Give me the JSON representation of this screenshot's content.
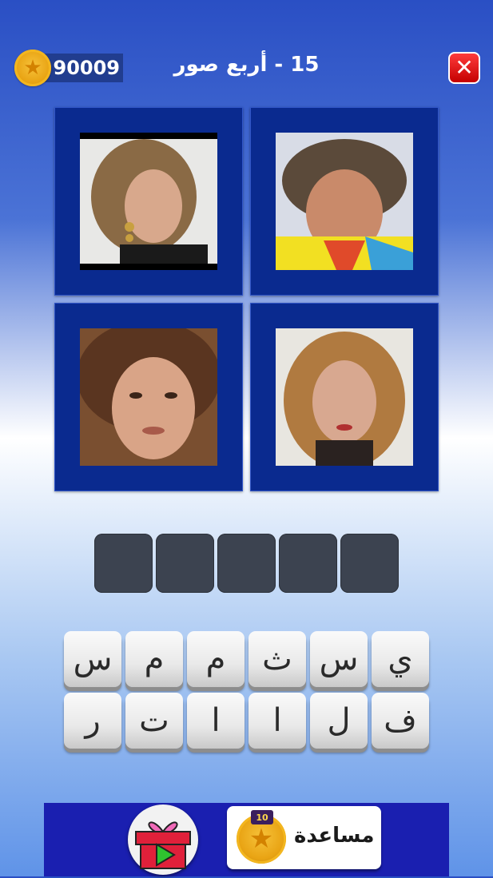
{
  "header": {
    "coins": "90009",
    "title": "15 - أربع صور",
    "close_glyph": "✕"
  },
  "photos": [
    {
      "name": "photo-1"
    },
    {
      "name": "photo-2"
    },
    {
      "name": "photo-3"
    },
    {
      "name": "photo-4"
    }
  ],
  "answer_slots_count": 5,
  "keyboard": {
    "row1": [
      "س",
      "م",
      "م",
      "ث",
      "س",
      "ي"
    ],
    "row2": [
      "ر",
      "ت",
      "ا",
      "ا",
      "ل",
      "ف"
    ]
  },
  "footer": {
    "help_label": "مساعدة",
    "help_cost": "10"
  },
  "colors": {
    "tile_bg": "#0a2a8f",
    "slot_bg": "#3c4350",
    "footer_bg": "#1a1fb0",
    "close_red": "#e21a1a"
  }
}
